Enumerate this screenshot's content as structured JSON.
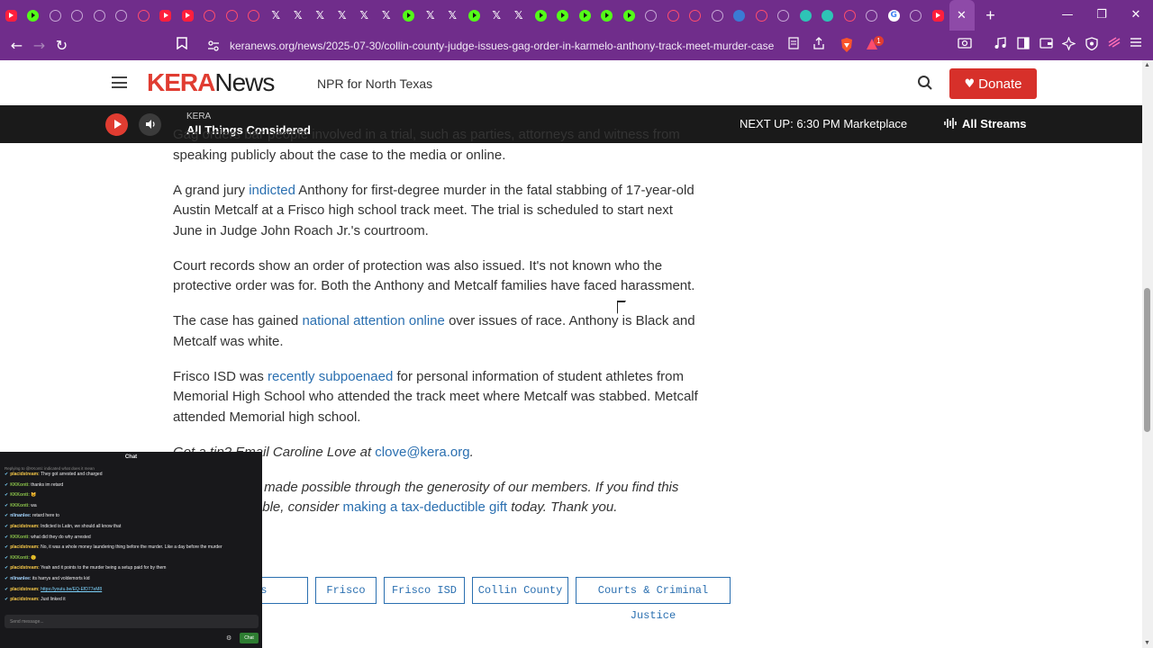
{
  "browser": {
    "tabs": [
      {
        "icon": "youtube"
      },
      {
        "icon": "kick"
      },
      {
        "icon": "ring"
      },
      {
        "icon": "ring"
      },
      {
        "icon": "ring"
      },
      {
        "icon": "ring"
      },
      {
        "icon": "rring"
      },
      {
        "icon": "youtube"
      },
      {
        "icon": "youtube"
      },
      {
        "icon": "rring"
      },
      {
        "icon": "rring"
      },
      {
        "icon": "rring"
      },
      {
        "icon": "x"
      },
      {
        "icon": "x"
      },
      {
        "icon": "x"
      },
      {
        "icon": "x"
      },
      {
        "icon": "x"
      },
      {
        "icon": "x"
      },
      {
        "icon": "kick"
      },
      {
        "icon": "x"
      },
      {
        "icon": "x"
      },
      {
        "icon": "kick"
      },
      {
        "icon": "x"
      },
      {
        "icon": "x"
      },
      {
        "icon": "kick"
      },
      {
        "icon": "kick"
      },
      {
        "icon": "kick"
      },
      {
        "icon": "kick"
      },
      {
        "icon": "kick"
      },
      {
        "icon": "ring"
      },
      {
        "icon": "rring"
      },
      {
        "icon": "rring"
      },
      {
        "icon": "ring"
      },
      {
        "icon": "blue"
      },
      {
        "icon": "rring"
      },
      {
        "icon": "ring"
      },
      {
        "icon": "teal"
      },
      {
        "icon": "teal"
      },
      {
        "icon": "rring"
      },
      {
        "icon": "ring"
      },
      {
        "icon": "google"
      },
      {
        "icon": "ring"
      },
      {
        "icon": "youtube"
      },
      {
        "icon": "active"
      }
    ],
    "active_tab_close": "✕",
    "new_tab": "+",
    "window_controls": {
      "minimize": "—",
      "restore": "❐",
      "close": "✕"
    },
    "nav": {
      "back": "←",
      "forward": "→",
      "reload": "↻"
    },
    "url": "keranews.org/news/2025-07-30/collin-county-judge-issues-gag-order-in-karmelo-anthony-track-meet-murder-case",
    "notification_count": "1"
  },
  "site": {
    "logo_part1": "KERA",
    "logo_part2": "News",
    "tagline": "NPR for North Texas",
    "donate": "Donate",
    "brand_color": "#e03c31"
  },
  "player": {
    "station": "KERA",
    "program": "All Things Considered",
    "next_up": "NEXT UP: 6:30 PM Marketplace",
    "all_streams": "All Streams"
  },
  "article": {
    "p1": "Gag orders bar people involved in a trial, such as parties, attorneys and witness from speaking publicly about the case to the media or online.",
    "p2_a": "A grand jury ",
    "p2_link": "indicted",
    "p2_b": " Anthony for first-degree murder in the fatal stabbing of 17-year-old Austin Metcalf at a Frisco high school track meet. The trial is scheduled to start next June in Judge John Roach Jr.'s courtroom.",
    "p3": "Court records show an order of protection was also issued. It's not known who the protective order was for. Both the Anthony and Metcalf families have faced harassment.",
    "p4_a": "The case has gained ",
    "p4_link": "national attention online",
    "p4_b": " over issues of race. Anthony is Black and Metcalf was white.",
    "p5_a": "Frisco ISD was ",
    "p5_link": "recently subpoenaed",
    "p5_b": " for personal information of student athletes from Memorial High School who attended the track meet where Metcalf was stabbed. Metcalf attended Memorial high school.",
    "p6_a": "Got a tip? Email Caroline Love at ",
    "p6_link": "clove@kera.org",
    "p6_b": ".",
    "p7_a": "KERA News is made possible through the generosity of our members. If you find this reporting valuable, consider ",
    "p7_link": "making a tax-deductible gift",
    "p7_b": " today. Thank you."
  },
  "tags": [
    "KERA News",
    "Frisco",
    "Frisco ISD",
    "Collin County",
    "Courts & Criminal Justice"
  ],
  "chat": {
    "title": "Chat",
    "reply_note": "Replying to @KKonti: indicated what does it mean",
    "messages": [
      {
        "user": "placidstream",
        "color": "#f7c948",
        "text": "They got arrested and charged"
      },
      {
        "user": "KKKonti",
        "color": "#8bc34a",
        "text": "thanks im retard"
      },
      {
        "user": "KKKonti",
        "color": "#8bc34a",
        "text": "😺"
      },
      {
        "user": "KKKonti",
        "color": "#8bc34a",
        "text": "wa"
      },
      {
        "user": "nlinanlee",
        "color": "#a5d6ff",
        "text": "retard here to"
      },
      {
        "user": "placidstream",
        "color": "#f7c948",
        "text": "Indicted is Latin, we should all know that"
      },
      {
        "user": "KKKonti",
        "color": "#8bc34a",
        "text": "what did they do why arrested"
      },
      {
        "user": "placidstream",
        "color": "#f7c948",
        "text": "No, it was a whole money laundering thing before the murder. Like a day before the murder"
      },
      {
        "user": "KKKonti",
        "color": "#8bc34a",
        "text": "🤨"
      },
      {
        "user": "placidstream",
        "color": "#f7c948",
        "text": "Yeah and it points to the murder being a setup paid for by them"
      },
      {
        "user": "nlinanlee",
        "color": "#a5d6ff",
        "text": "its harrys and voldemorts kid"
      },
      {
        "user": "placidstream",
        "color": "#f7c948",
        "text": "https://youtu.be/EQ-EfD77eM8"
      },
      {
        "user": "placidstream",
        "color": "#f7c948",
        "text": "Just linked it"
      }
    ],
    "input_placeholder": "Send message...",
    "send_label": "Chat"
  }
}
